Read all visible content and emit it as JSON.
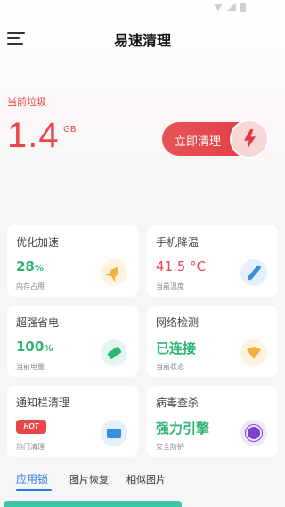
{
  "app": {
    "title": "易速清理"
  },
  "junk": {
    "label": "当前垃圾",
    "value": "1.4",
    "unit": "GB"
  },
  "clean_button": {
    "label": "立即清理"
  },
  "cards": [
    {
      "title": "优化加速",
      "value": "28",
      "value_suffix": "%",
      "sub": "内存占用",
      "value_color": "#2bb673",
      "icon": "rocket-icon"
    },
    {
      "title": "手机降温",
      "value": "41.5 °C",
      "sub": "当前温度",
      "value_color": "#e8474c",
      "icon": "thermometer-icon"
    },
    {
      "title": "超强省电",
      "value": "100",
      "value_suffix": "%",
      "sub": "当前电量",
      "value_color": "#2bb673",
      "icon": "battery-icon"
    },
    {
      "title": "网络检测",
      "value": "已连接",
      "sub": "当前状态",
      "value_color": "#2bb673",
      "icon": "wifi-icon"
    },
    {
      "title": "通知栏清理",
      "badge": "HOT",
      "sub": "热门清理",
      "icon": "notification-icon"
    },
    {
      "title": "病毒查杀",
      "value": "强力引擎",
      "sub": "安全防护",
      "value_color": "#2bb673",
      "icon": "virus-icon"
    }
  ],
  "tabs": [
    {
      "label": "应用锁",
      "active": true
    },
    {
      "label": "图片恢复",
      "active": false
    },
    {
      "label": "相似图片",
      "active": false
    }
  ],
  "colors": {
    "accent_red": "#e8474c",
    "accent_green": "#2bb673",
    "accent_blue": "#2c79e3"
  }
}
